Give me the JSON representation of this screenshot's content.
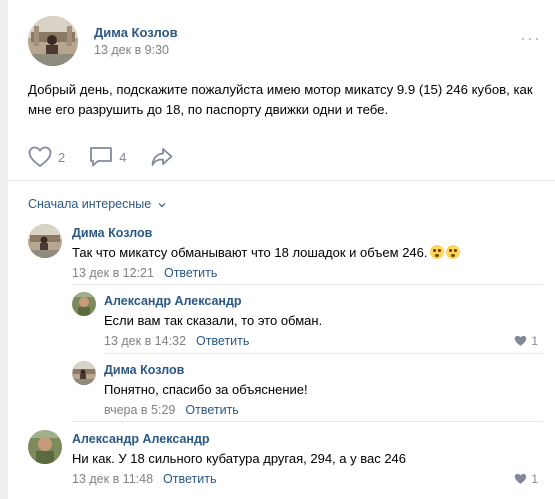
{
  "post": {
    "author": "Дима Козлов",
    "date": "13 дек в 9:30",
    "text": "Добрый день, подскажите пожалуйста имею мотор микатсу 9.9 (15) 246 кубов, как мне его разрушить до 18, по паспорту движки одни и тебе.",
    "likes": "2",
    "comments": "4",
    "more_icon": "more-dots-icon"
  },
  "comments": {
    "sort_label": "Сначала интересные",
    "reply_label": "Ответить",
    "items": [
      {
        "author": "Дима Козлов",
        "text": "Так что микатсу обманывают что 18 лошадок и объем 246.",
        "date": "13 дек в 12:21",
        "emojis": [
          "flushed-face-emoji",
          "astonished-face-emoji"
        ]
      },
      {
        "author": "Александр Александр",
        "text": "Если вам так сказали, то это обман.",
        "date": "13 дек в 14:32",
        "likes": "1"
      },
      {
        "author": "Дима Козлов",
        "text": "Понятно, спасибо за объяснение!",
        "date": "вчера в 5:29"
      },
      {
        "author": "Александр Александр",
        "text": "Ни как. У 18 сильного кубатура другая, 294, а у вас 246",
        "date": "13 дек в 11:48",
        "likes": "1"
      }
    ]
  },
  "colors": {
    "link": "#2a5885",
    "muted": "#828282",
    "icon": "#828a99",
    "background": "#edeef0"
  }
}
